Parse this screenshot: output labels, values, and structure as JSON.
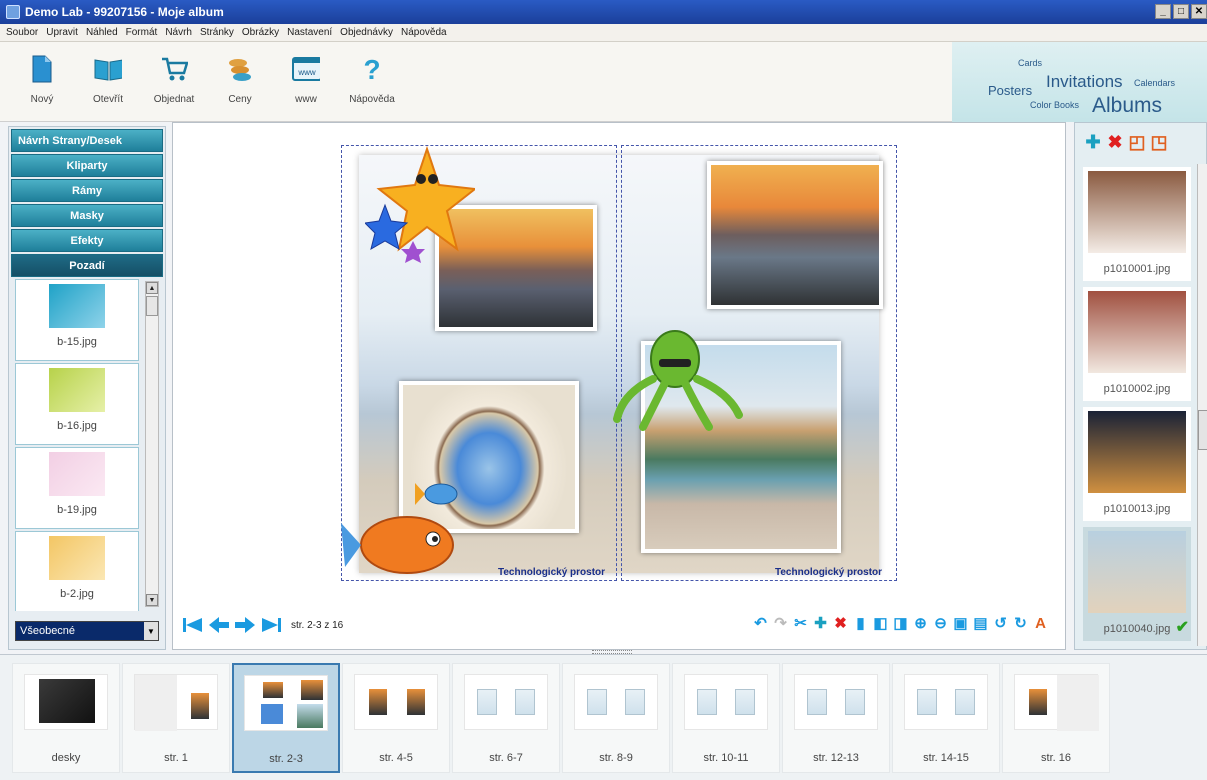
{
  "window": {
    "title": "Demo Lab - 99207156 - Moje album"
  },
  "menu": [
    "Soubor",
    "Upravit",
    "Náhled",
    "Formát",
    "Návrh",
    "Stránky",
    "Obrázky",
    "Nastavení",
    "Objednávky",
    "Nápověda"
  ],
  "toolbar": [
    {
      "label": "Nový",
      "icon": "new-file-icon"
    },
    {
      "label": "Otevřít",
      "icon": "open-book-icon"
    },
    {
      "label": "Objednat",
      "icon": "cart-icon"
    },
    {
      "label": "Ceny",
      "icon": "coins-icon"
    },
    {
      "label": "www",
      "icon": "www-icon"
    },
    {
      "label": "Nápověda",
      "icon": "help-icon"
    }
  ],
  "brand": {
    "cards": "Cards",
    "posters": "Posters",
    "invitations": "Invitations",
    "calendars": "Calendars",
    "colorbooks": "Color Books",
    "albums": "Albums"
  },
  "left": {
    "sections": [
      "Návrh Strany/Desek",
      "Kliparty",
      "Rámy",
      "Masky",
      "Efekty",
      "Pozadí"
    ],
    "active_section": "Pozadí",
    "backgrounds": [
      {
        "name": "b-15.jpg",
        "colors": [
          "#1fa2c7",
          "#8fd3ea"
        ]
      },
      {
        "name": "b-16.jpg",
        "colors": [
          "#b7d24a",
          "#e6f0a8"
        ]
      },
      {
        "name": "b-19.jpg",
        "colors": [
          "#f2cfe4",
          "#fbe9f3"
        ]
      },
      {
        "name": "b-2.jpg",
        "colors": [
          "#f3c664",
          "#fbe7b4"
        ]
      }
    ],
    "category": "Všeobecné"
  },
  "canvas": {
    "label_left": "Technologický prostor",
    "label_right": "Technologický prostor",
    "page_info": "str. 2-3 z 16"
  },
  "right": {
    "photos": [
      {
        "name": "p1010001.jpg",
        "colors": [
          "#8a5a40",
          "#f4ece6"
        ]
      },
      {
        "name": "p1010002.jpg",
        "colors": [
          "#a05040",
          "#f1e8e0"
        ]
      },
      {
        "name": "p1010013.jpg",
        "colors": [
          "#1a2236",
          "#d09040"
        ]
      },
      {
        "name": "p1010040.jpg",
        "colors": [
          "#b8d0e0",
          "#e2d2bc"
        ]
      }
    ],
    "selected": "p1010040.jpg"
  },
  "strip": [
    {
      "name": "desky"
    },
    {
      "name": "str. 1"
    },
    {
      "name": "str. 2-3"
    },
    {
      "name": "str. 4-5"
    },
    {
      "name": "str. 6-7"
    },
    {
      "name": "str. 8-9"
    },
    {
      "name": "str. 10-11"
    },
    {
      "name": "str. 12-13"
    },
    {
      "name": "str. 14-15"
    },
    {
      "name": "str. 16"
    }
  ],
  "strip_selected": "str. 2-3",
  "colors": {
    "accent": "#1f7f9a",
    "title": "#1b3f9a",
    "nav": "#1a9ae0",
    "delete": "#e02020",
    "add": "#1aa0c0"
  }
}
